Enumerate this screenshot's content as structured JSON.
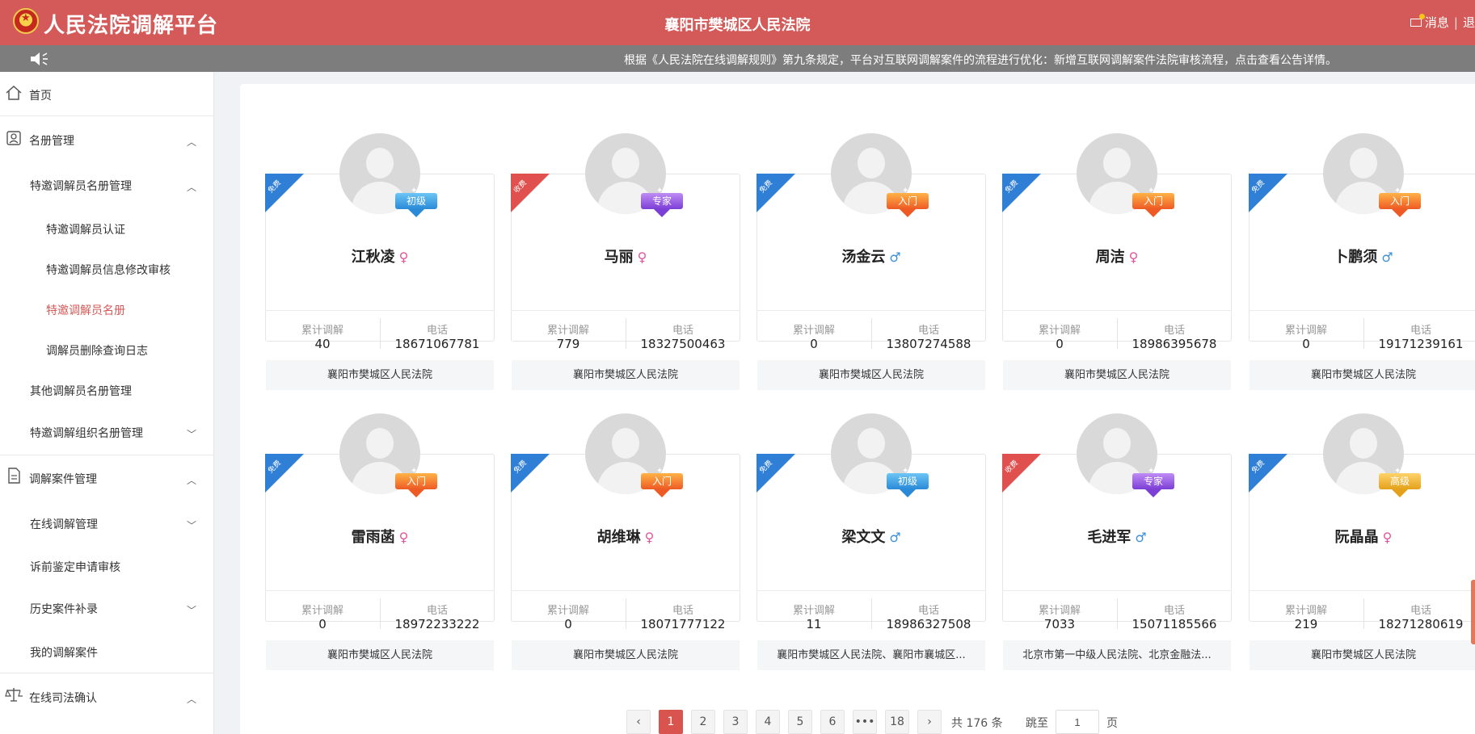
{
  "header": {
    "brand": "人民法院调解平台",
    "court": "襄阳市樊城区人民法院",
    "messages": "消息",
    "more": "退"
  },
  "notice": {
    "text": "根据《人民法院在线调解规则》第九条规定，平台对互联网调解案件的流程进行优化：新增互联网调解案件法院审核流程，点击查看公告详情。"
  },
  "sidebar": {
    "home": "首页",
    "roster": "名册管理",
    "special_roster": "特邀调解员名册管理",
    "special_cert": "特邀调解员认证",
    "special_review": "特邀调解员信息修改审核",
    "special_list": "特邀调解员名册",
    "delete_log": "调解员删除查询日志",
    "other_roster": "其他调解员名册管理",
    "org_roster": "特邀调解组织名册管理",
    "cases": "调解案件管理",
    "online": "在线调解管理",
    "appraisal": "诉前鉴定申请审核",
    "history": "历史案件补录",
    "mine": "我的调解案件",
    "judicial": "在线司法确认"
  },
  "labels": {
    "count": "累计调解",
    "phone": "电话"
  },
  "accent": "#d35a58",
  "cards": [
    {
      "name": "江秋凌",
      "gender": "♀",
      "level": "初级",
      "fee": "免费",
      "count": "40",
      "phone": "18671067781",
      "court": "襄阳市樊城区人民法院"
    },
    {
      "name": "马丽",
      "gender": "♀",
      "level": "专家",
      "fee": "收费",
      "count": "779",
      "phone": "18327500463",
      "court": "襄阳市樊城区人民法院"
    },
    {
      "name": "汤金云",
      "gender": "♂",
      "level": "入门",
      "fee": "免费",
      "count": "0",
      "phone": "13807274588",
      "court": "襄阳市樊城区人民法院"
    },
    {
      "name": "周洁",
      "gender": "♀",
      "level": "入门",
      "fee": "免费",
      "count": "0",
      "phone": "18986395678",
      "court": "襄阳市樊城区人民法院"
    },
    {
      "name": "卜鹏须",
      "gender": "♂",
      "level": "入门",
      "fee": "免费",
      "count": "0",
      "phone": "19171239161",
      "court": "襄阳市樊城区人民法院"
    },
    {
      "name": "雷雨菡",
      "gender": "♀",
      "level": "入门",
      "fee": "免费",
      "count": "0",
      "phone": "18972233222",
      "court": "襄阳市樊城区人民法院"
    },
    {
      "name": "胡维琳",
      "gender": "♀",
      "level": "入门",
      "fee": "免费",
      "count": "0",
      "phone": "18071777122",
      "court": "襄阳市樊城区人民法院"
    },
    {
      "name": "梁文文",
      "gender": "♂",
      "level": "初级",
      "fee": "免费",
      "count": "11",
      "phone": "18986327508",
      "court": "襄阳市樊城区人民法院、襄阳市襄城区..."
    },
    {
      "name": "毛进军",
      "gender": "♂",
      "level": "专家",
      "fee": "收费",
      "count": "7033",
      "phone": "15071185566",
      "court": "北京市第一中级人民法院、北京金融法..."
    },
    {
      "name": "阮晶晶",
      "gender": "♀",
      "level": "高级",
      "fee": "免费",
      "count": "219",
      "phone": "18271280619",
      "court": "襄阳市樊城区人民法院"
    }
  ],
  "pagination": {
    "pages": [
      "1",
      "2",
      "3",
      "4",
      "5",
      "6",
      "•••",
      "18"
    ],
    "total": "共 176 条",
    "jump": "跳至",
    "current": "1",
    "page_unit": "页",
    "prev": "‹",
    "next": "›"
  }
}
